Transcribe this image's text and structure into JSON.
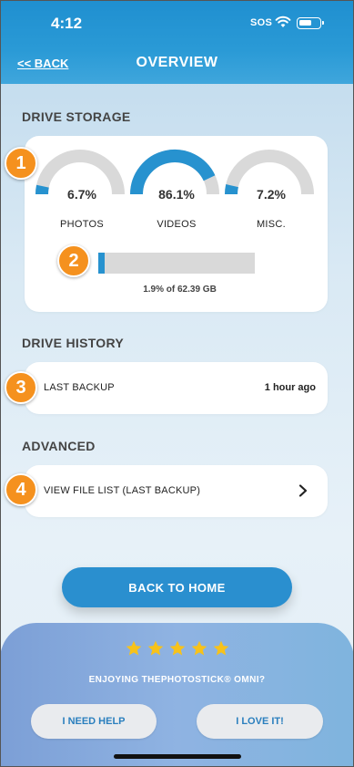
{
  "status_bar": {
    "time": "4:12",
    "sos": "SOS"
  },
  "header": {
    "back_label": "<< BACK",
    "title": "OVERVIEW"
  },
  "drive_storage": {
    "heading": "DRIVE STORAGE",
    "gauges": [
      {
        "label": "PHOTOS",
        "value_text": "6.7%",
        "value": 6.7
      },
      {
        "label": "VIDEOS",
        "value_text": "86.1%",
        "value": 86.1
      },
      {
        "label": "MISC.",
        "value_text": "7.2%",
        "value": 7.2
      }
    ],
    "used_percent": 1.9,
    "usage_text": "1.9% of 62.39 GB"
  },
  "drive_history": {
    "heading": "DRIVE HISTORY",
    "last_backup_label": "LAST BACKUP",
    "last_backup_value": "1 hour ago"
  },
  "advanced": {
    "heading": "ADVANCED",
    "file_list_label": "VIEW FILE LIST (LAST BACKUP)"
  },
  "callouts": [
    "1",
    "2",
    "3",
    "4"
  ],
  "home_button_label": "BACK TO HOME",
  "feedback": {
    "stars": 5,
    "question": "ENJOYING THEPHOTOSTICK® OMNI?",
    "help_label": "I NEED HELP",
    "love_label": "I LOVE IT!"
  },
  "colors": {
    "accent": "#2792cf",
    "gauge_track": "#d9d9d9",
    "callout": "#f5911e",
    "star": "#f7c21a"
  }
}
